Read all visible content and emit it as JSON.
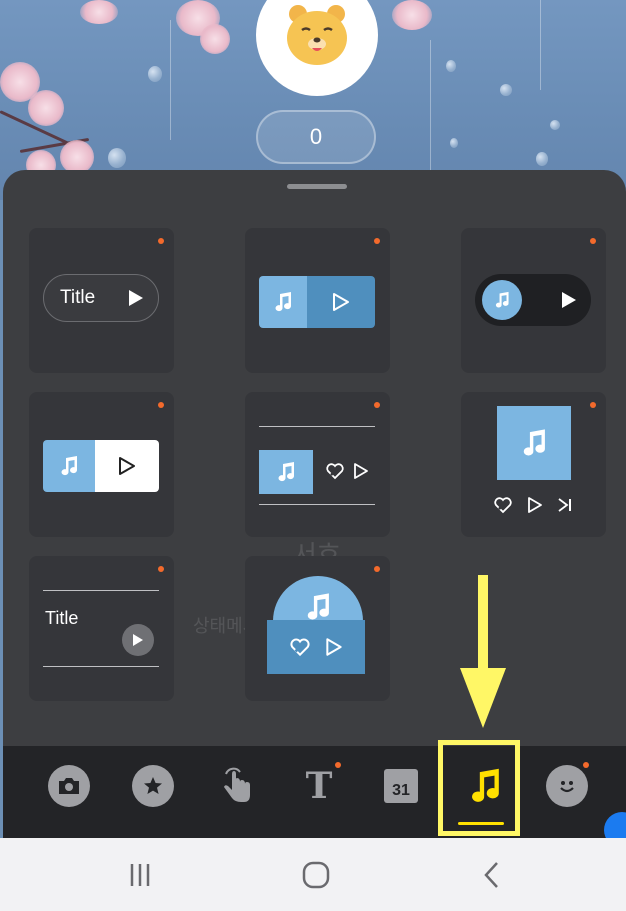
{
  "profile": {
    "counter_value": "0",
    "avatar": "bear-character-icon"
  },
  "background_ghost": {
    "name_partial": "서호",
    "status_partial": "상태메시"
  },
  "widgets": [
    {
      "id": "pill-title-play",
      "title": "Title",
      "icons": [
        "play-icon"
      ],
      "new": true
    },
    {
      "id": "blue-split-player",
      "icons": [
        "music-note-icon",
        "play-outline-icon"
      ],
      "new": true
    },
    {
      "id": "dark-pill-disc-player",
      "icons": [
        "music-note-icon",
        "play-icon"
      ],
      "new": true
    },
    {
      "id": "blue-white-split-player",
      "icons": [
        "music-note-icon",
        "play-outline-icon"
      ],
      "new": true
    },
    {
      "id": "lined-album-player",
      "icons": [
        "music-note-icon",
        "heart-broken-icon",
        "play-outline-icon"
      ],
      "new": true
    },
    {
      "id": "square-album-player",
      "icons": [
        "music-note-icon",
        "heart-broken-icon",
        "play-outline-icon",
        "skip-next-icon"
      ],
      "new": true
    },
    {
      "id": "lined-title-player",
      "title": "Title",
      "icons": [
        "play-icon"
      ],
      "new": true
    },
    {
      "id": "dome-album-player",
      "icons": [
        "music-note-icon",
        "heart-broken-icon",
        "play-outline-icon"
      ],
      "new": true
    }
  ],
  "toolbar": {
    "items": [
      {
        "name": "camera",
        "icon": "camera-icon",
        "new": false
      },
      {
        "name": "sticker",
        "icon": "sticker-icon",
        "new": false
      },
      {
        "name": "touch",
        "icon": "touch-hand-icon",
        "new": false
      },
      {
        "name": "text",
        "icon": "text-icon",
        "label": "T",
        "new": true
      },
      {
        "name": "calendar",
        "icon": "calendar-icon",
        "label": "31",
        "new": false
      },
      {
        "name": "music",
        "icon": "music-note-icon",
        "new": false,
        "selected": true
      },
      {
        "name": "emoji",
        "icon": "smiley-icon",
        "new": true
      }
    ]
  },
  "annotation": {
    "color": "#fff766",
    "target": "music"
  },
  "colors": {
    "accent_blue": "#7cb6e1",
    "accent_blue_dark": "#4f8fbe",
    "new_dot": "#f36a2c",
    "selected_underline": "#ffe000"
  }
}
